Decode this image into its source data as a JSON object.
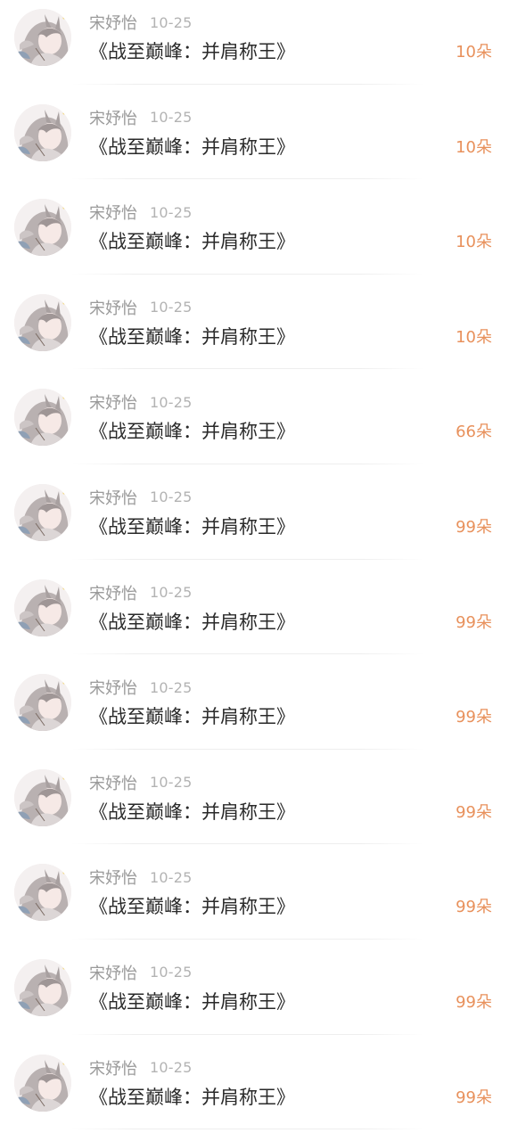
{
  "theme": {
    "amount_color": "#e8915c",
    "name_color": "#9a9a9a",
    "title_color": "#2a2a2a",
    "avatar_icon": "anime-girl-avatar-icon"
  },
  "records": [
    {
      "name": "宋妤怡",
      "date": "10-25",
      "title": "《战至巅峰：并肩称王》",
      "amount": "10朵"
    },
    {
      "name": "宋妤怡",
      "date": "10-25",
      "title": "《战至巅峰：并肩称王》",
      "amount": "10朵"
    },
    {
      "name": "宋妤怡",
      "date": "10-25",
      "title": "《战至巅峰：并肩称王》",
      "amount": "10朵"
    },
    {
      "name": "宋妤怡",
      "date": "10-25",
      "title": "《战至巅峰：并肩称王》",
      "amount": "10朵"
    },
    {
      "name": "宋妤怡",
      "date": "10-25",
      "title": "《战至巅峰：并肩称王》",
      "amount": "66朵"
    },
    {
      "name": "宋妤怡",
      "date": "10-25",
      "title": "《战至巅峰：并肩称王》",
      "amount": "99朵"
    },
    {
      "name": "宋妤怡",
      "date": "10-25",
      "title": "《战至巅峰：并肩称王》",
      "amount": "99朵"
    },
    {
      "name": "宋妤怡",
      "date": "10-25",
      "title": "《战至巅峰：并肩称王》",
      "amount": "99朵"
    },
    {
      "name": "宋妤怡",
      "date": "10-25",
      "title": "《战至巅峰：并肩称王》",
      "amount": "99朵"
    },
    {
      "name": "宋妤怡",
      "date": "10-25",
      "title": "《战至巅峰：并肩称王》",
      "amount": "99朵"
    },
    {
      "name": "宋妤怡",
      "date": "10-25",
      "title": "《战至巅峰：并肩称王》",
      "amount": "99朵"
    },
    {
      "name": "宋妤怡",
      "date": "10-25",
      "title": "《战至巅峰：并肩称王》",
      "amount": "99朵"
    }
  ]
}
